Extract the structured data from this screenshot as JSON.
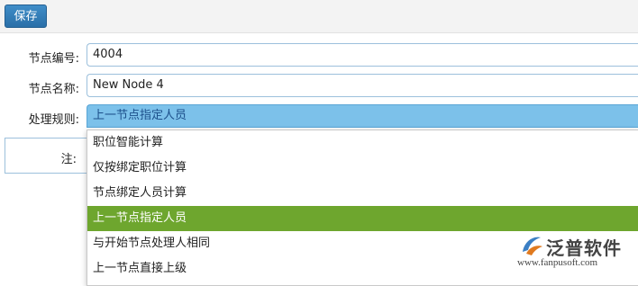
{
  "toolbar": {
    "save_label": "保存"
  },
  "form": {
    "node_code": {
      "label": "节点编号:",
      "value": "4004"
    },
    "node_name": {
      "label": "节点名称:",
      "value": "New Node 4"
    },
    "rule": {
      "label": "处理规则:",
      "value": "上一节点指定人员"
    },
    "note": {
      "label": "注:"
    }
  },
  "dropdown": {
    "options": [
      "职位智能计算",
      "仅按绑定职位计算",
      "节点绑定人员计算",
      "上一节点指定人员",
      "与开始节点处理人相同",
      "上一节点直接上级"
    ],
    "selected_index": 3
  },
  "watermark": {
    "brand": "泛普软件",
    "url": "www.fanpusoft.com"
  },
  "colors": {
    "accent": "#2a6fa8",
    "selected": "#6ea62e",
    "select_bg": "#7cc1ea"
  }
}
